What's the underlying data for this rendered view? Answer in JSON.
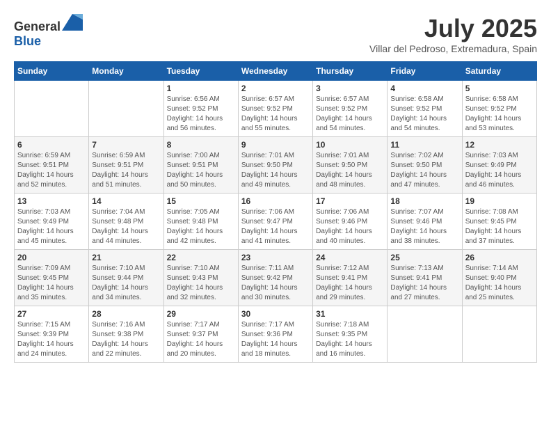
{
  "logo": {
    "text_general": "General",
    "text_blue": "Blue"
  },
  "title": "July 2025",
  "location": "Villar del Pedroso, Extremadura, Spain",
  "weekdays": [
    "Sunday",
    "Monday",
    "Tuesday",
    "Wednesday",
    "Thursday",
    "Friday",
    "Saturday"
  ],
  "weeks": [
    [
      {
        "day": "",
        "sunrise": "",
        "sunset": "",
        "daylight": ""
      },
      {
        "day": "",
        "sunrise": "",
        "sunset": "",
        "daylight": ""
      },
      {
        "day": "1",
        "sunrise": "Sunrise: 6:56 AM",
        "sunset": "Sunset: 9:52 PM",
        "daylight": "Daylight: 14 hours and 56 minutes."
      },
      {
        "day": "2",
        "sunrise": "Sunrise: 6:57 AM",
        "sunset": "Sunset: 9:52 PM",
        "daylight": "Daylight: 14 hours and 55 minutes."
      },
      {
        "day": "3",
        "sunrise": "Sunrise: 6:57 AM",
        "sunset": "Sunset: 9:52 PM",
        "daylight": "Daylight: 14 hours and 54 minutes."
      },
      {
        "day": "4",
        "sunrise": "Sunrise: 6:58 AM",
        "sunset": "Sunset: 9:52 PM",
        "daylight": "Daylight: 14 hours and 54 minutes."
      },
      {
        "day": "5",
        "sunrise": "Sunrise: 6:58 AM",
        "sunset": "Sunset: 9:52 PM",
        "daylight": "Daylight: 14 hours and 53 minutes."
      }
    ],
    [
      {
        "day": "6",
        "sunrise": "Sunrise: 6:59 AM",
        "sunset": "Sunset: 9:51 PM",
        "daylight": "Daylight: 14 hours and 52 minutes."
      },
      {
        "day": "7",
        "sunrise": "Sunrise: 6:59 AM",
        "sunset": "Sunset: 9:51 PM",
        "daylight": "Daylight: 14 hours and 51 minutes."
      },
      {
        "day": "8",
        "sunrise": "Sunrise: 7:00 AM",
        "sunset": "Sunset: 9:51 PM",
        "daylight": "Daylight: 14 hours and 50 minutes."
      },
      {
        "day": "9",
        "sunrise": "Sunrise: 7:01 AM",
        "sunset": "Sunset: 9:50 PM",
        "daylight": "Daylight: 14 hours and 49 minutes."
      },
      {
        "day": "10",
        "sunrise": "Sunrise: 7:01 AM",
        "sunset": "Sunset: 9:50 PM",
        "daylight": "Daylight: 14 hours and 48 minutes."
      },
      {
        "day": "11",
        "sunrise": "Sunrise: 7:02 AM",
        "sunset": "Sunset: 9:50 PM",
        "daylight": "Daylight: 14 hours and 47 minutes."
      },
      {
        "day": "12",
        "sunrise": "Sunrise: 7:03 AM",
        "sunset": "Sunset: 9:49 PM",
        "daylight": "Daylight: 14 hours and 46 minutes."
      }
    ],
    [
      {
        "day": "13",
        "sunrise": "Sunrise: 7:03 AM",
        "sunset": "Sunset: 9:49 PM",
        "daylight": "Daylight: 14 hours and 45 minutes."
      },
      {
        "day": "14",
        "sunrise": "Sunrise: 7:04 AM",
        "sunset": "Sunset: 9:48 PM",
        "daylight": "Daylight: 14 hours and 44 minutes."
      },
      {
        "day": "15",
        "sunrise": "Sunrise: 7:05 AM",
        "sunset": "Sunset: 9:48 PM",
        "daylight": "Daylight: 14 hours and 42 minutes."
      },
      {
        "day": "16",
        "sunrise": "Sunrise: 7:06 AM",
        "sunset": "Sunset: 9:47 PM",
        "daylight": "Daylight: 14 hours and 41 minutes."
      },
      {
        "day": "17",
        "sunrise": "Sunrise: 7:06 AM",
        "sunset": "Sunset: 9:46 PM",
        "daylight": "Daylight: 14 hours and 40 minutes."
      },
      {
        "day": "18",
        "sunrise": "Sunrise: 7:07 AM",
        "sunset": "Sunset: 9:46 PM",
        "daylight": "Daylight: 14 hours and 38 minutes."
      },
      {
        "day": "19",
        "sunrise": "Sunrise: 7:08 AM",
        "sunset": "Sunset: 9:45 PM",
        "daylight": "Daylight: 14 hours and 37 minutes."
      }
    ],
    [
      {
        "day": "20",
        "sunrise": "Sunrise: 7:09 AM",
        "sunset": "Sunset: 9:45 PM",
        "daylight": "Daylight: 14 hours and 35 minutes."
      },
      {
        "day": "21",
        "sunrise": "Sunrise: 7:10 AM",
        "sunset": "Sunset: 9:44 PM",
        "daylight": "Daylight: 14 hours and 34 minutes."
      },
      {
        "day": "22",
        "sunrise": "Sunrise: 7:10 AM",
        "sunset": "Sunset: 9:43 PM",
        "daylight": "Daylight: 14 hours and 32 minutes."
      },
      {
        "day": "23",
        "sunrise": "Sunrise: 7:11 AM",
        "sunset": "Sunset: 9:42 PM",
        "daylight": "Daylight: 14 hours and 30 minutes."
      },
      {
        "day": "24",
        "sunrise": "Sunrise: 7:12 AM",
        "sunset": "Sunset: 9:41 PM",
        "daylight": "Daylight: 14 hours and 29 minutes."
      },
      {
        "day": "25",
        "sunrise": "Sunrise: 7:13 AM",
        "sunset": "Sunset: 9:41 PM",
        "daylight": "Daylight: 14 hours and 27 minutes."
      },
      {
        "day": "26",
        "sunrise": "Sunrise: 7:14 AM",
        "sunset": "Sunset: 9:40 PM",
        "daylight": "Daylight: 14 hours and 25 minutes."
      }
    ],
    [
      {
        "day": "27",
        "sunrise": "Sunrise: 7:15 AM",
        "sunset": "Sunset: 9:39 PM",
        "daylight": "Daylight: 14 hours and 24 minutes."
      },
      {
        "day": "28",
        "sunrise": "Sunrise: 7:16 AM",
        "sunset": "Sunset: 9:38 PM",
        "daylight": "Daylight: 14 hours and 22 minutes."
      },
      {
        "day": "29",
        "sunrise": "Sunrise: 7:17 AM",
        "sunset": "Sunset: 9:37 PM",
        "daylight": "Daylight: 14 hours and 20 minutes."
      },
      {
        "day": "30",
        "sunrise": "Sunrise: 7:17 AM",
        "sunset": "Sunset: 9:36 PM",
        "daylight": "Daylight: 14 hours and 18 minutes."
      },
      {
        "day": "31",
        "sunrise": "Sunrise: 7:18 AM",
        "sunset": "Sunset: 9:35 PM",
        "daylight": "Daylight: 14 hours and 16 minutes."
      },
      {
        "day": "",
        "sunrise": "",
        "sunset": "",
        "daylight": ""
      },
      {
        "day": "",
        "sunrise": "",
        "sunset": "",
        "daylight": ""
      }
    ]
  ]
}
